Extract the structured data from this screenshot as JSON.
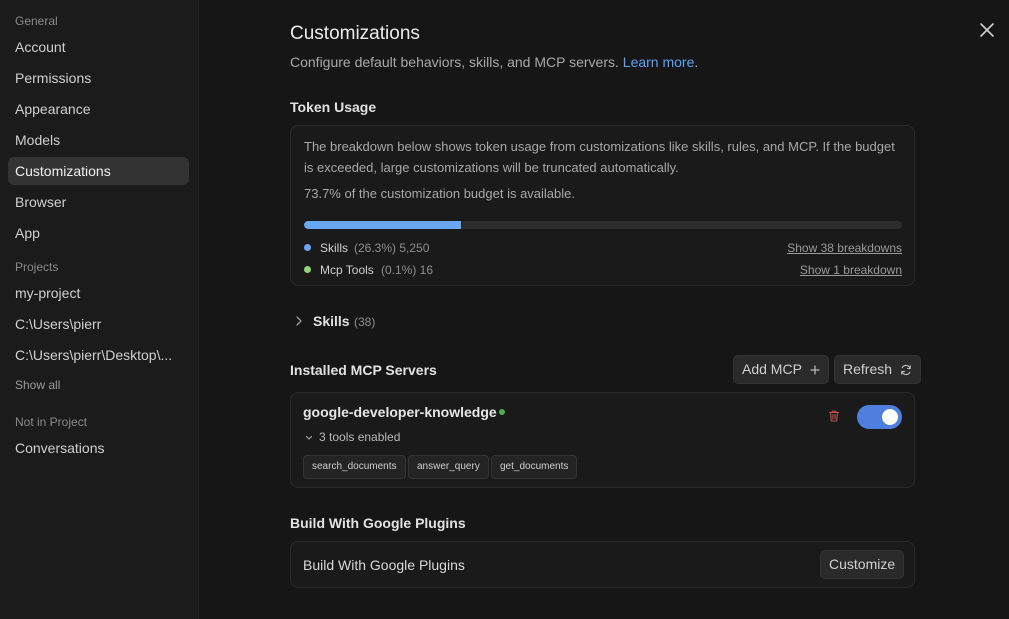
{
  "sidebar": {
    "general_label": "General",
    "general_items": [
      "Account",
      "Permissions",
      "Appearance",
      "Models",
      "Customizations",
      "Browser",
      "App"
    ],
    "projects_label": "Projects",
    "project_items": [
      "my-project",
      "C:\\Users\\pierr",
      "C:\\Users\\pierr\\Desktop\\..."
    ],
    "show_all": "Show all",
    "not_in_project_label": "Not in Project",
    "other_items": [
      "Conversations"
    ]
  },
  "header": {
    "title": "Customizations",
    "subtitle": "Configure default behaviors, skills, and MCP servers.",
    "learn_more": "Learn more",
    "subtitle_end": "."
  },
  "token_usage": {
    "title": "Token Usage",
    "description": "The breakdown below shows token usage from customizations like skills, rules, and MCP. If the budget is exceeded, large customizations will be truncated automatically.",
    "budget_text": "73.7% of the customization budget is available.",
    "progress_fraction": 0.263,
    "rows": [
      {
        "name": "Skills",
        "meta": "(26.3%) 5,250",
        "link": "Show 38 breakdowns",
        "color": "#6aa7f2"
      },
      {
        "name": "Mcp Tools",
        "meta": "(0.1%) 16",
        "link": "Show 1 breakdown",
        "color": "#8fd47a"
      }
    ]
  },
  "skills": {
    "label": "Skills",
    "count": "(38)"
  },
  "mcp": {
    "title": "Installed MCP Servers",
    "add_label": "Add MCP",
    "refresh_label": "Refresh",
    "server": {
      "name": "google-developer-knowledge",
      "tools_enabled": "3 tools enabled",
      "tools": [
        "search_documents",
        "answer_query",
        "get_documents"
      ],
      "enabled": true
    }
  },
  "plugins": {
    "title": "Build With Google Plugins",
    "row_label": "Build With Google Plugins",
    "customize_label": "Customize"
  }
}
